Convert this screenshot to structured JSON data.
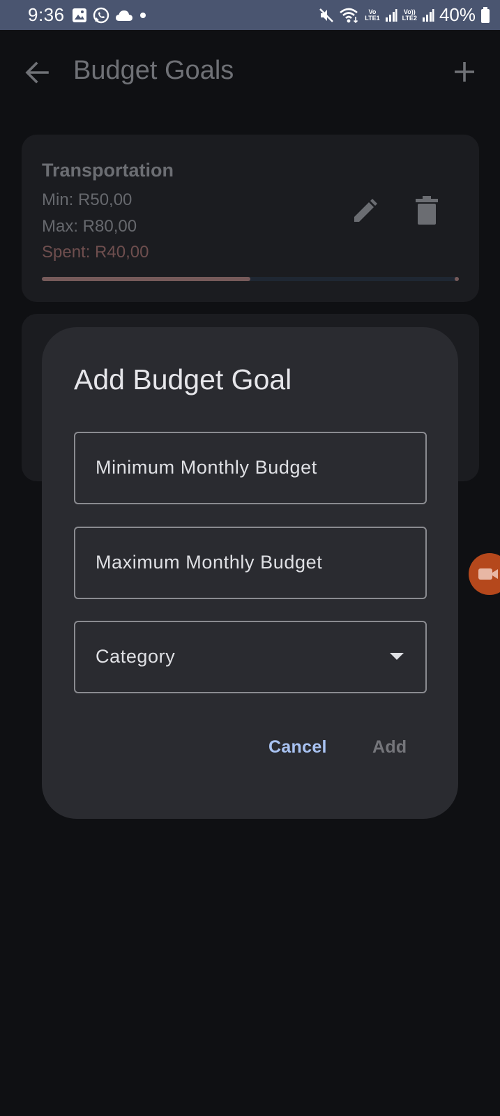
{
  "status_bar": {
    "time": "9:36",
    "battery": "40%",
    "sim1_top": "Vo",
    "sim1_bottom": "LTE1",
    "sim2_top": "Vo))",
    "sim2_bottom": "LTE2"
  },
  "app_bar": {
    "title": "Budget Goals"
  },
  "goals": [
    {
      "category": "Transportation",
      "min": "Min: R50,00",
      "max": "Max: R80,00",
      "spent": "Spent: R40,00",
      "progress": 0.5
    }
  ],
  "dialog": {
    "title": "Add Budget Goal",
    "min_field_label": "Minimum Monthly Budget",
    "max_field_label": "Maximum Monthly Budget",
    "category_label": "Category",
    "cancel_label": "Cancel",
    "add_label": "Add"
  },
  "colors": {
    "accent": "#a9c3f2",
    "spent": "#765a5a",
    "recording_button": "#b5481c"
  }
}
